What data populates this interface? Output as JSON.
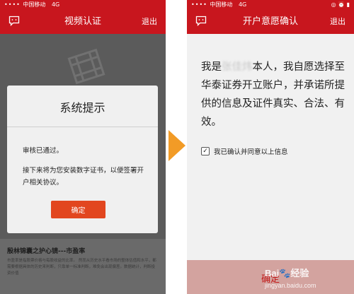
{
  "left_screen": {
    "status": {
      "carrier": "中国移动",
      "network": "4G"
    },
    "nav": {
      "title": "视频认证",
      "exit": "退出",
      "icon": "chat-bubble-icon"
    },
    "dialog": {
      "title": "系统提示",
      "message1": "审核已通过。",
      "message2": "接下来将为您安装数字证书，以便签署开户相关协议。",
      "confirm": "确定"
    },
    "article": {
      "title": "殷林锦囊之护心镜---市盈率",
      "body": "市盈率是指股票价格与每股收益的比率。 然而从历史水平看市场的整体估值和水平，都需要根据具体的历史来判断，只靠单一标准判断，难免会出现偏差。数据统计，判断投资价值"
    }
  },
  "right_screen": {
    "status": {
      "carrier": "中国移动",
      "network": "4G"
    },
    "nav": {
      "title": "开户意愿确认",
      "exit": "退出",
      "icon": "chat-bubble-icon"
    },
    "statement": {
      "prefix": "我是",
      "name": "张佳炜",
      "suffix": "本人，我自愿选择至华泰证券开立账户，并承诺所提供的信息及证件真实、合法、有效。"
    },
    "agree": {
      "label": "我已确认并同意以上信息",
      "checked": true,
      "check_mark": "✓"
    },
    "bottom_button": "确定"
  },
  "watermark": {
    "brand": "Bai",
    "tail": "经验",
    "url": "jingyan.baidu.com"
  },
  "colors": {
    "brand_red": "#c8161e",
    "button_orange": "#e2461f",
    "arrow": "#f29b26"
  }
}
